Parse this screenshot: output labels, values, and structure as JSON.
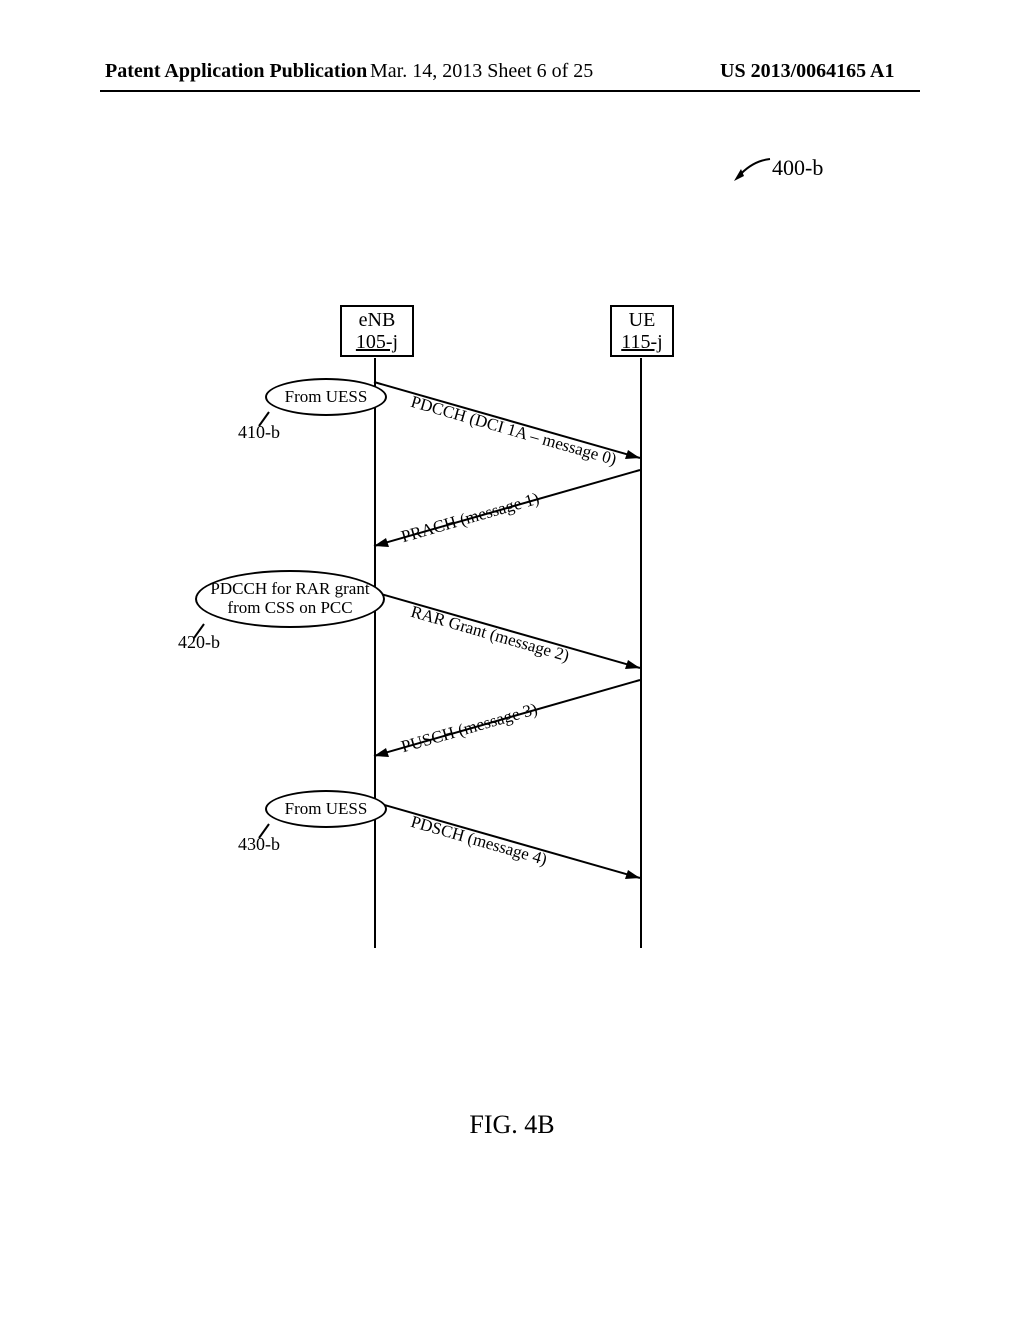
{
  "header": {
    "left": "Patent Application Publication",
    "mid": "Mar. 14, 2013  Sheet 6 of 25",
    "right": "US 2013/0064165 A1"
  },
  "figref": "400-b",
  "enb": {
    "title": "eNB",
    "id": "105-j"
  },
  "ue": {
    "title": "UE",
    "id": "115-j"
  },
  "messages": {
    "m0": "PDCCH (DCI 1A – message 0)",
    "m1": "PRACH (message 1)",
    "m2": "RAR Grant (message 2)",
    "m3": "PUSCH (message 3)",
    "m4": "PDSCH (message 4)"
  },
  "annotations": {
    "a1_text": "From UESS",
    "a1_ref": "410-b",
    "a2_text": "PDCCH for RAR grant from CSS on PCC",
    "a2_ref": "420-b",
    "a3_text": "From UESS",
    "a3_ref": "430-b"
  },
  "figcaption": "FIG. 4B"
}
